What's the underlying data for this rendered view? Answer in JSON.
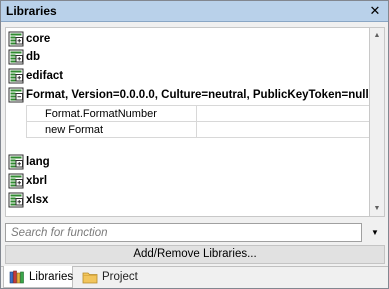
{
  "window": {
    "title": "Libraries",
    "close_glyph": "✕"
  },
  "libraries": [
    {
      "name": "core",
      "icon": "library-icon"
    },
    {
      "name": "db",
      "icon": "library-icon"
    },
    {
      "name": "edifact",
      "icon": "library-icon"
    },
    {
      "name": "Format, Version=0.0.0.0, Culture=neutral, PublicKeyToken=null",
      "icon": "library-icon",
      "expanded": true
    },
    {
      "name": "lang",
      "icon": "library-icon"
    },
    {
      "name": "xbrl",
      "icon": "library-icon"
    },
    {
      "name": "xlsx",
      "icon": "library-icon"
    }
  ],
  "functions": [
    {
      "name": "Format.FormatNumber",
      "detail": ""
    },
    {
      "name": "new Format",
      "detail": ""
    }
  ],
  "search": {
    "placeholder": "Search for function",
    "value": ""
  },
  "add_remove_label": "Add/Remove Libraries...",
  "tabs": [
    {
      "label": "Libraries",
      "icon": "libraries-tab-icon",
      "active": true
    },
    {
      "label": "Project",
      "icon": "folder-icon",
      "active": false
    }
  ],
  "colors": {
    "titlebar": "#b9d1ea",
    "icon_green": "#2f8a2f"
  }
}
